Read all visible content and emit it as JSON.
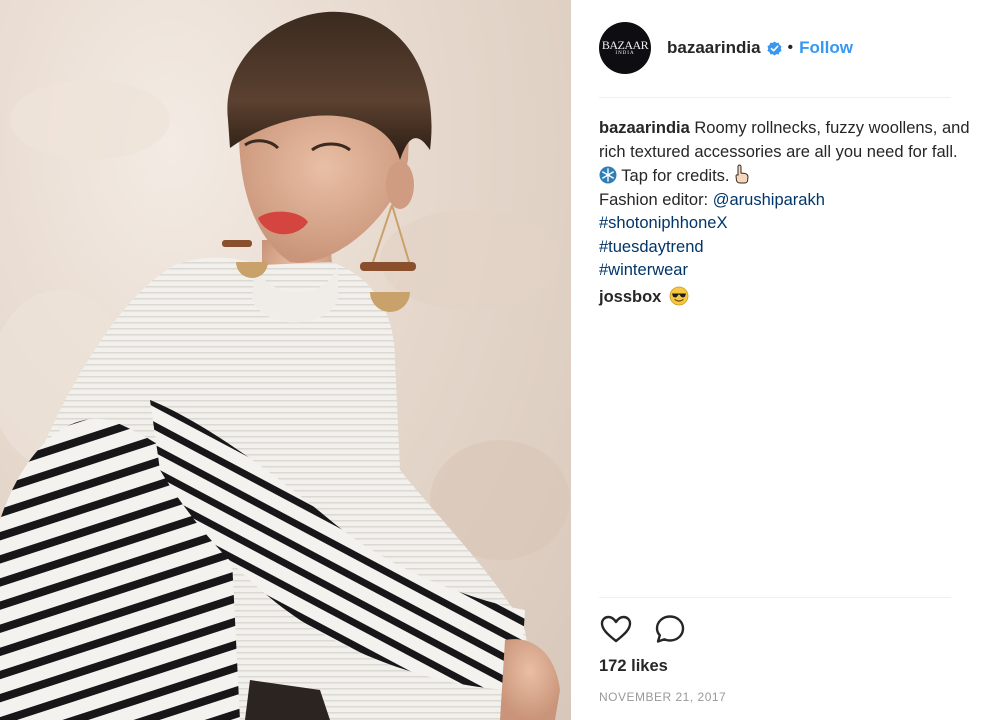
{
  "post": {
    "username": "bazaarindia",
    "follow_label": "Follow",
    "separator": "•",
    "avatar": {
      "logo": "BAZAAR",
      "sub": "INDIA"
    }
  },
  "caption": {
    "username": "bazaarindia",
    "text_1": "Roomy rollnecks, fuzzy woollens, and rich textured accessories are all you need for fall.",
    "text_2": "Tap for credits.",
    "editor_prefix": "Fashion editor:",
    "editor_handle": "@arushiparakh",
    "hashtags": [
      "#shotoniphhoneX",
      "#tuesdaytrend",
      "#winterwear"
    ]
  },
  "comment": {
    "username": "jossbox"
  },
  "likes_text": "172 likes",
  "date_text": "NOVEMBER 21, 2017",
  "colors": {
    "link": "#003569",
    "follow": "#3897f0",
    "verified": "#3897f0",
    "meta": "#999999"
  },
  "icons": [
    "verified-badge-icon",
    "snowflake-emoji-icon",
    "pointing-hand-emoji-icon",
    "sunglasses-emoji-icon",
    "heart-icon",
    "comment-icon"
  ]
}
